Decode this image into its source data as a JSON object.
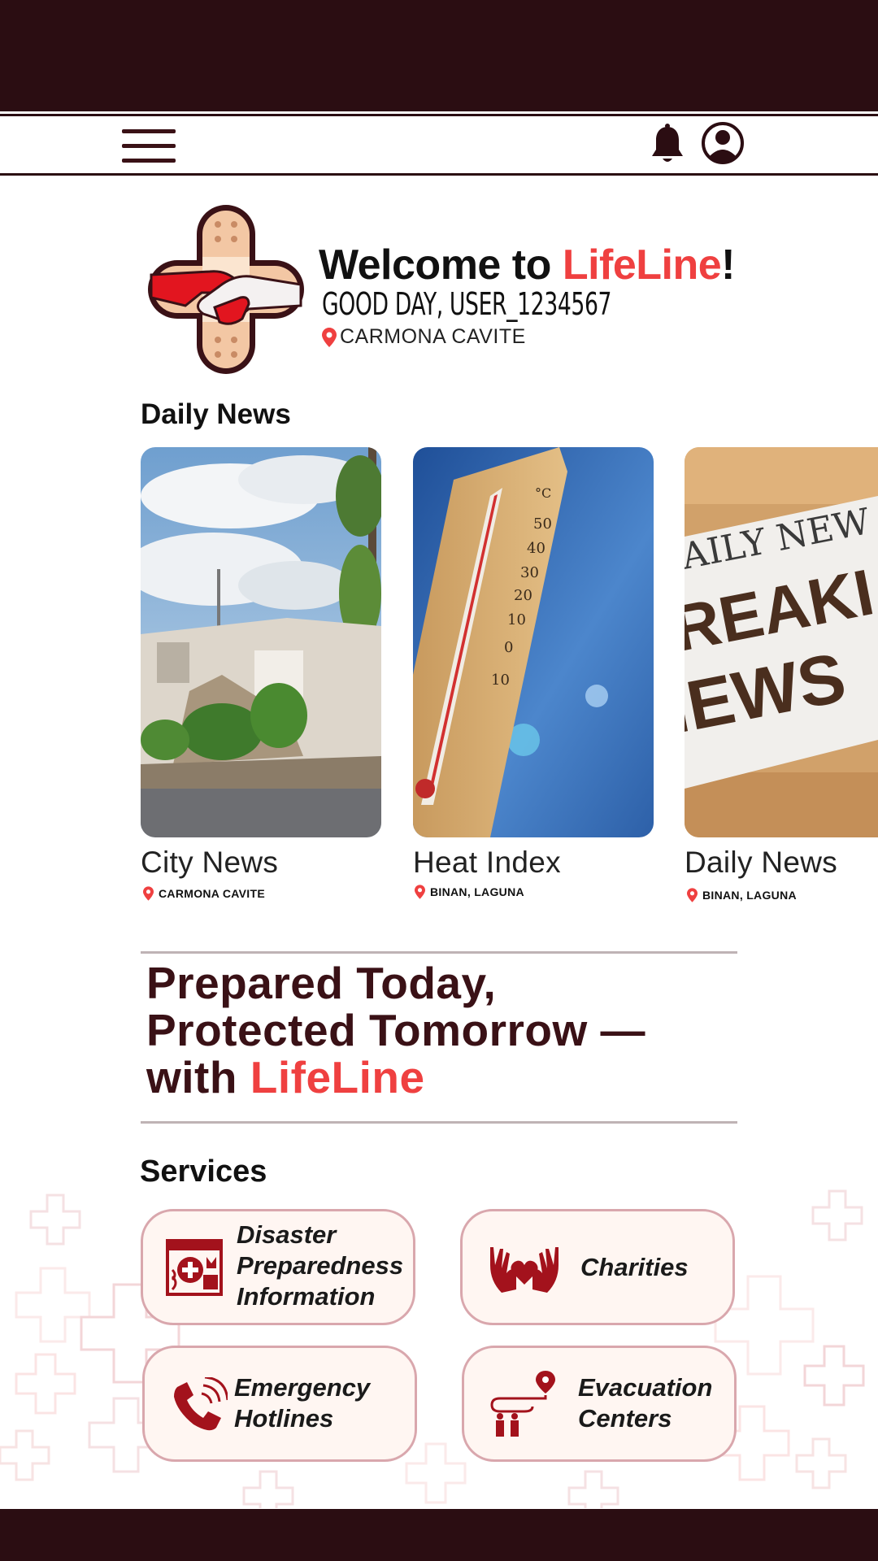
{
  "app": {
    "brand": "LifeLine",
    "welcome_prefix": "Welcome to ",
    "welcome_suffix": "!",
    "greeting": "GOOD DAY, USER_1234567",
    "location": "CARMONA CAVITE"
  },
  "header": {
    "menu_icon": "hamburger-menu-icon",
    "bell_icon": "bell-icon",
    "profile_icon": "user-circle-icon"
  },
  "news": {
    "title": "Daily News",
    "items": [
      {
        "label": "City News",
        "location": "CARMONA CAVITE",
        "image": "storm-damaged-house"
      },
      {
        "label": "Heat Index",
        "location": "BINAN, LAGUNA",
        "image": "thermometer-blue-sky"
      },
      {
        "label": "Daily News",
        "location": "BINAN, LAGUNA",
        "image": "breaking-news-newspaper"
      }
    ]
  },
  "tagline": {
    "line1": "Prepared Today,",
    "line2": "Protected Tomorrow —",
    "line3_prefix": "with ",
    "line3_brand": "LifeLine"
  },
  "services": {
    "title": "Services",
    "items": [
      {
        "label": "Disaster\nPreparedness\nInformation",
        "icon": "disaster-kit-icon"
      },
      {
        "label": "Charities",
        "icon": "hands-heart-icon"
      },
      {
        "label": "Emergency\nHotlines",
        "icon": "phone-icon"
      },
      {
        "label": "Evacuation\nCenters",
        "icon": "route-people-icon"
      }
    ]
  },
  "colors": {
    "primary_dark": "#2b0d12",
    "accent_red": "#ef4040",
    "icon_red": "#a3121c",
    "service_bg": "#fff6f2",
    "service_border": "#d9a7ad"
  }
}
